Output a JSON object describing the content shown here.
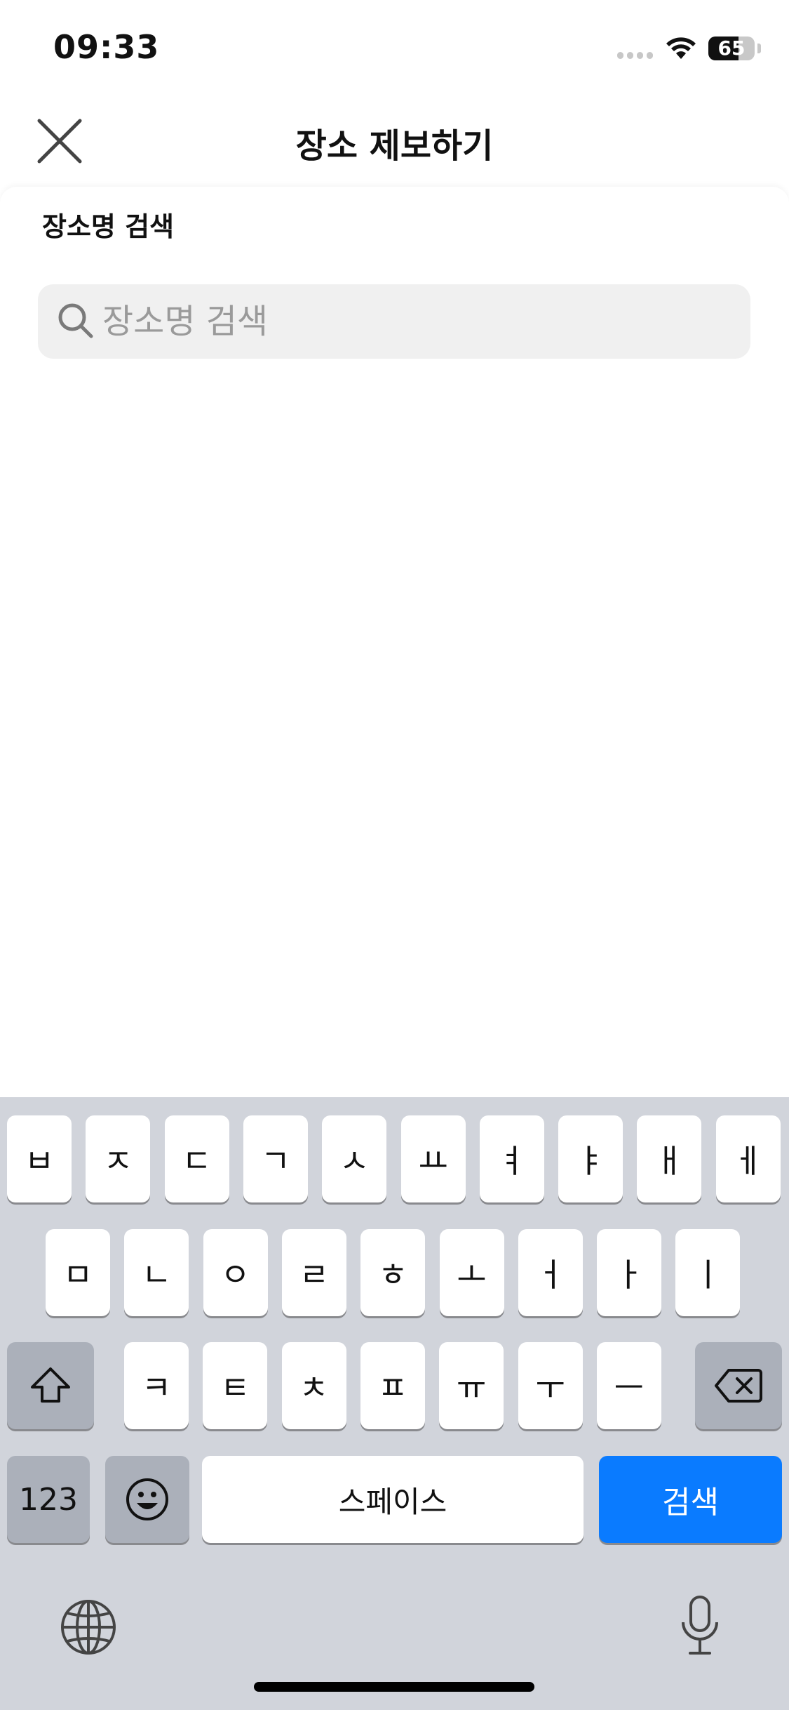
{
  "status_bar": {
    "time": "09:33",
    "battery": "65",
    "battery_level": 0.65
  },
  "header": {
    "title": "장소 제보하기",
    "close_icon": "close-icon"
  },
  "section": {
    "label": "장소명 검색"
  },
  "search": {
    "placeholder": "장소명 검색",
    "value": "",
    "icon": "search-icon"
  },
  "keyboard": {
    "row1": [
      "ㅂ",
      "ㅈ",
      "ㄷ",
      "ㄱ",
      "ㅅ",
      "ㅛ",
      "ㅕ",
      "ㅑ",
      "ㅐ",
      "ㅔ"
    ],
    "row2": [
      "ㅁ",
      "ㄴ",
      "ㅇ",
      "ㄹ",
      "ㅎ",
      "ㅗ",
      "ㅓ",
      "ㅏ",
      "ㅣ"
    ],
    "row3": [
      "ㅋ",
      "ㅌ",
      "ㅊ",
      "ㅍ",
      "ㅠ",
      "ㅜ",
      "ㅡ"
    ],
    "numbers_label": "123",
    "space_label": "스페이스",
    "search_label": "검색",
    "icons": [
      "shift-icon",
      "backspace-icon",
      "emoji-icon",
      "globe-icon",
      "microphone-icon"
    ],
    "colors": {
      "background": "#d1d4db",
      "key": "#ffffff",
      "dark_key": "#abb0ba",
      "accent": "#0a7bff"
    }
  }
}
